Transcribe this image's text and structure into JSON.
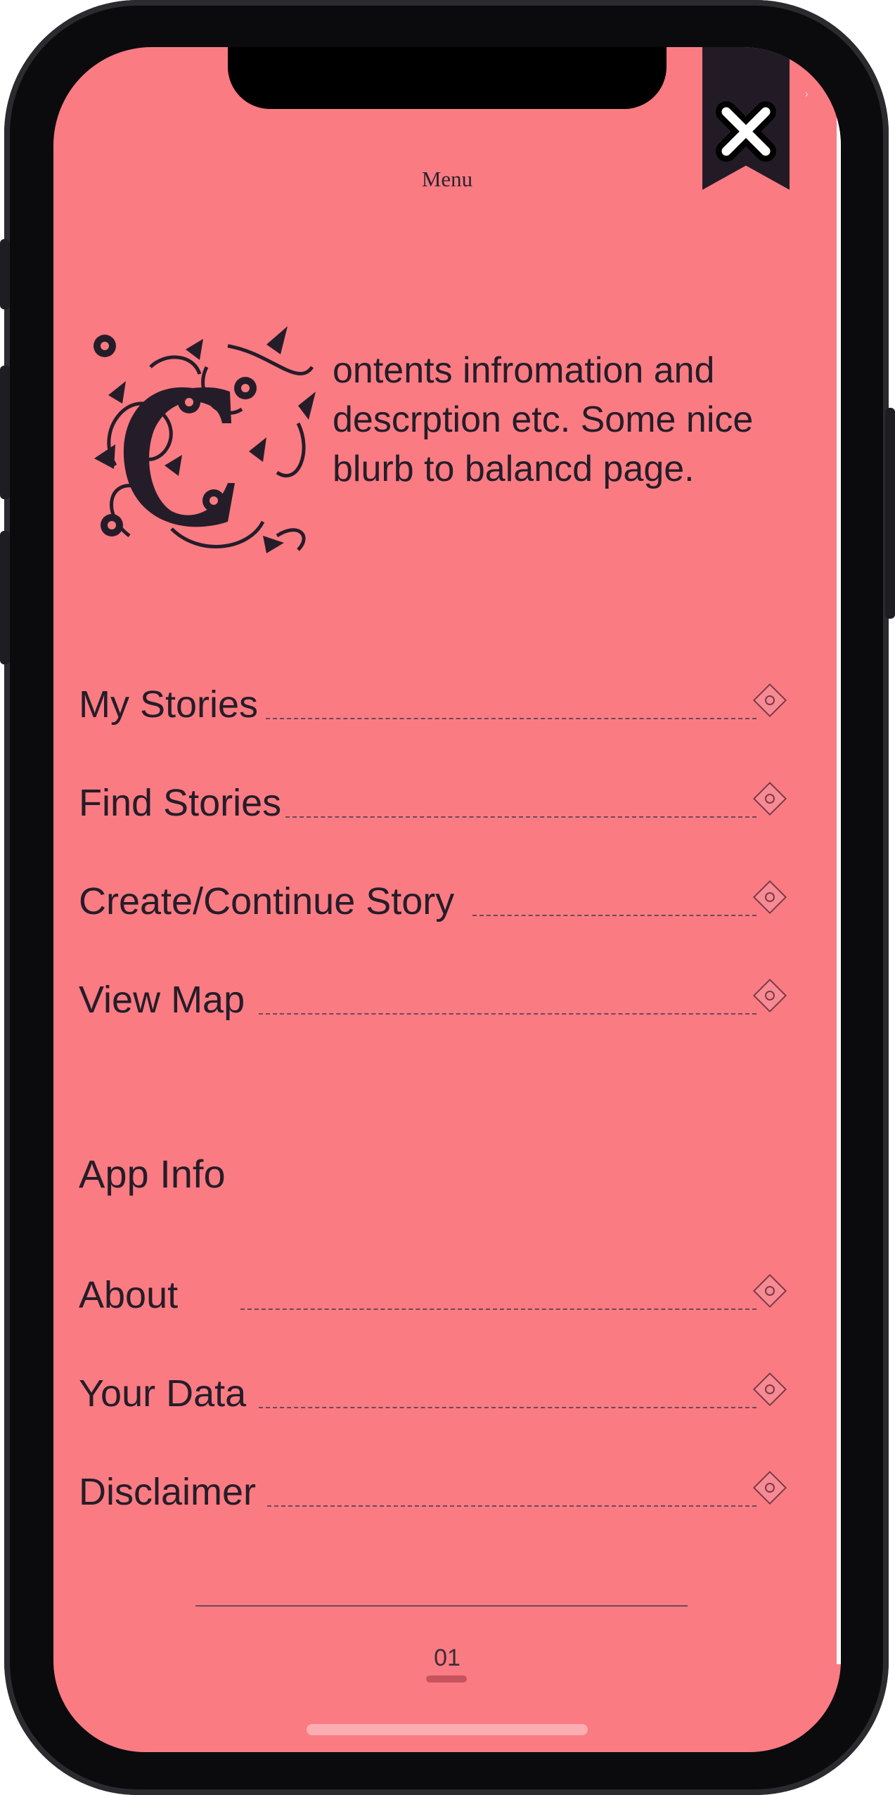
{
  "theme": {
    "background": "#fb7b82",
    "ink": "#241d29",
    "bookmark": "#221b26"
  },
  "header": {
    "title": "Menu",
    "close_icon": "close-icon"
  },
  "intro": {
    "dropcap_letter": "C",
    "text": "ontents infromation and descrption etc. Some nice blurb to balancd page."
  },
  "menu": {
    "items": [
      {
        "label": "My Stories",
        "icon": "diamond-bullet-icon"
      },
      {
        "label": "Find Stories",
        "icon": "diamond-bullet-icon"
      },
      {
        "label": "Create/Continue Story",
        "icon": "diamond-bullet-icon"
      },
      {
        "label": "View Map",
        "icon": "diamond-bullet-icon"
      }
    ]
  },
  "app_info": {
    "heading": "App Info",
    "items": [
      {
        "label": "About",
        "icon": "diamond-bullet-icon"
      },
      {
        "label": "Your Data",
        "icon": "diamond-bullet-icon"
      },
      {
        "label": "Disclaimer",
        "icon": "diamond-bullet-icon"
      }
    ]
  },
  "footer": {
    "page_number": "01"
  }
}
